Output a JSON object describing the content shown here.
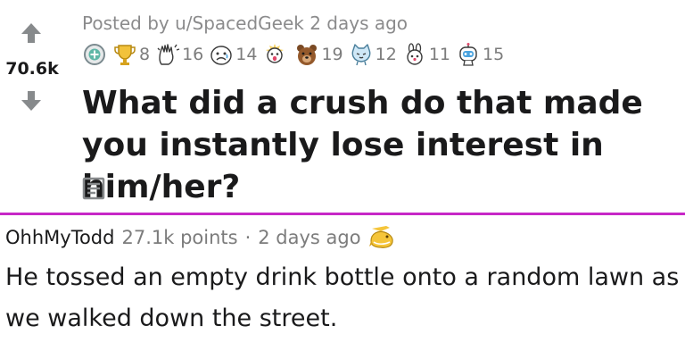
{
  "post": {
    "score": "70.6k",
    "meta": "Posted by u/SpacedGeek 2 days ago",
    "awards": [
      {
        "icon": "silver-award-icon",
        "count": ""
      },
      {
        "icon": "trophy-award-icon",
        "count": "8"
      },
      {
        "icon": "clapping-hands-award-icon",
        "count": "16"
      },
      {
        "icon": "sad-face-award-icon",
        "count": "14"
      },
      {
        "icon": "dog-award-icon",
        "count": ""
      },
      {
        "icon": "bear-award-icon",
        "count": "19"
      },
      {
        "icon": "cat-award-icon",
        "count": "12"
      },
      {
        "icon": "bunny-award-icon",
        "count": "11"
      },
      {
        "icon": "robot-award-icon",
        "count": "15"
      }
    ],
    "title": "What did a crush do that made you instantly lose interest in him/her?",
    "type_icon": "text-post-icon"
  },
  "comment": {
    "author": "OhhMyTodd",
    "points": "27.1k points",
    "separator": "·",
    "time": "2 days ago",
    "award_icon": "narwhal-award-icon",
    "body": "He tossed an empty drink bottle onto a random lawn as we walked down the street."
  },
  "colors": {
    "divider": "#c727c7",
    "vote_arrow": "#878a8c",
    "meta_text": "#8b8b8c"
  }
}
